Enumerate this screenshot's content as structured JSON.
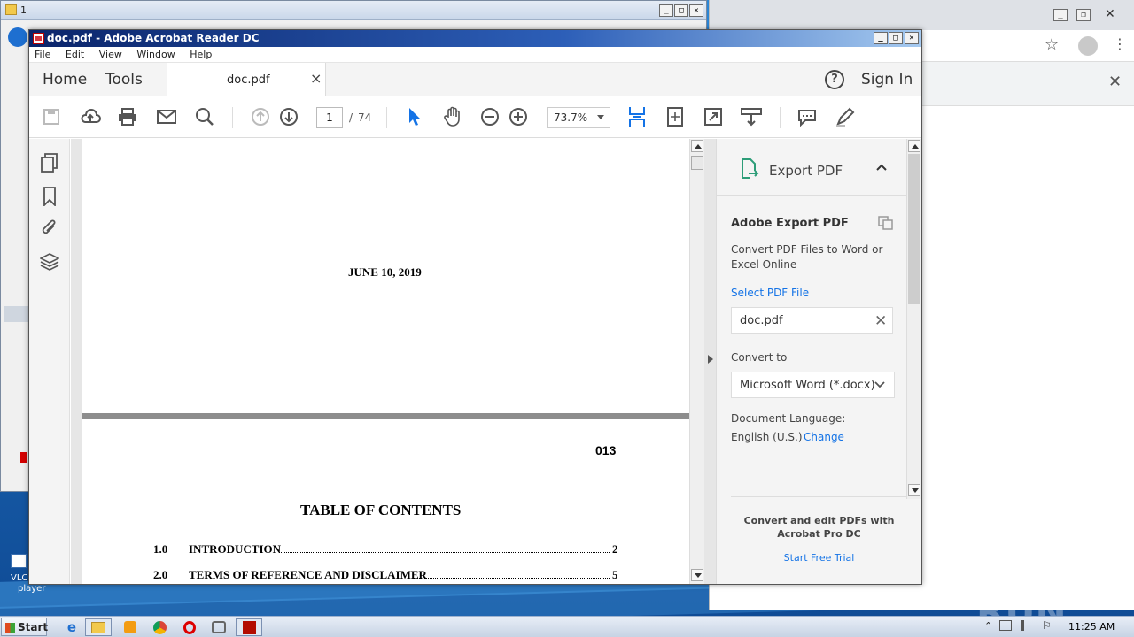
{
  "explorer": {
    "title": "1"
  },
  "chrome": {
    "close_glyph": "✕"
  },
  "acrobat": {
    "title": "doc.pdf - Adobe Acrobat Reader DC",
    "menu": [
      "File",
      "Edit",
      "View",
      "Window",
      "Help"
    ],
    "tabs": {
      "home": "Home",
      "tools": "Tools",
      "doc": "doc.pdf",
      "close": "×",
      "help": "?",
      "sign_in": "Sign In"
    },
    "toolbar": {
      "page_current": "1",
      "page_sep": "/",
      "page_total": "74",
      "zoom": "73.7%"
    },
    "document": {
      "date": "JUNE 10, 2019",
      "page_number": "013",
      "toc_title": "TABLE OF CONTENTS",
      "toc": [
        {
          "num": "1.0",
          "title": "INTRODUCTION",
          "page": "2"
        },
        {
          "num": "2.0",
          "title": "TERMS OF REFERENCE AND DISCLAIMER",
          "page": "5"
        }
      ]
    },
    "export": {
      "header": "Export PDF",
      "heading": "Adobe Export PDF",
      "description": "Convert PDF Files to Word or Excel Online",
      "select_label": "Select PDF File",
      "file": "doc.pdf",
      "convert_label": "Convert to",
      "convert_value": "Microsoft Word (*.docx)",
      "language_label": "Document Language:",
      "language_value": "English (U.S.)",
      "change": "Change",
      "promo": "Convert and edit PDFs with Acrobat Pro DC",
      "trial": "Start Free Trial"
    }
  },
  "desktop": {
    "icon_label_1": "VLC",
    "icon_label_2": "player",
    "watermark": "ANY RUN"
  },
  "taskbar": {
    "start": "Start",
    "clock": "11:25 AM"
  },
  "colors": {
    "acrobat_blue": "#1473e6",
    "acrobat_red": "#d7373f"
  }
}
